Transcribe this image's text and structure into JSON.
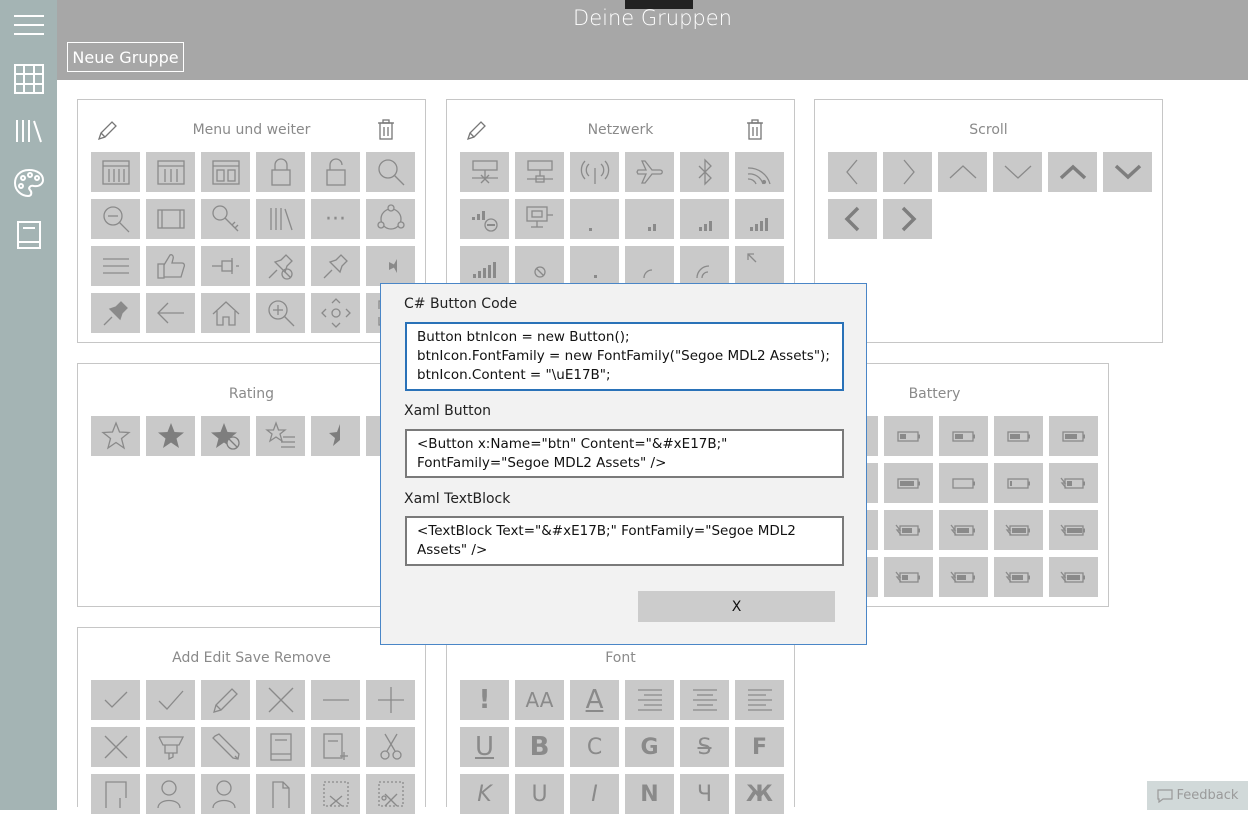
{
  "header": {
    "title": "Deine Gruppen",
    "new_group_label": "Neue Gruppe"
  },
  "sidebar": {
    "items": [
      "hamburger-icon",
      "grid-icon",
      "library-icon",
      "palette-icon",
      "book-icon"
    ]
  },
  "panels": [
    {
      "id": "menu",
      "title": "Menu und weiter",
      "editable": true
    },
    {
      "id": "netzwerk",
      "title": "Netzwerk",
      "editable": true
    },
    {
      "id": "scroll",
      "title": "Scroll",
      "editable": false
    },
    {
      "id": "rating",
      "title": "Rating",
      "editable": false
    },
    {
      "id": "battery",
      "title": "Battery",
      "editable": false
    },
    {
      "id": "add-edit",
      "title": "Add Edit Save Remove",
      "editable": false
    },
    {
      "id": "font",
      "title": "Font",
      "editable": false
    }
  ],
  "font_glyphs": [
    "!",
    "AA",
    "A",
    "",
    "",
    "",
    "U",
    "B",
    "C",
    "G",
    "S",
    "F",
    "K",
    "U",
    "I",
    "N",
    "Ч",
    "Ж"
  ],
  "dialog": {
    "csharp_label": "C# Button Code",
    "csharp_code": "Button btnIcon = new Button();\nbtnIcon.FontFamily = new FontFamily(\"Segoe MDL2 Assets\");\nbtnIcon.Content = \"\\uE17B\";",
    "xaml_button_label": "Xaml Button",
    "xaml_button_code": "<Button x:Name=\"btn\" Content=\"&#xE17B;\" FontFamily=\"Segoe MDL2 Assets\" />",
    "xaml_textblock_label": "Xaml TextBlock",
    "xaml_textblock_code": "<TextBlock Text=\"&#xE17B;\" FontFamily=\"Segoe MDL2 Assets\" />",
    "close_label": "X"
  },
  "feedback_label": "Feedback"
}
